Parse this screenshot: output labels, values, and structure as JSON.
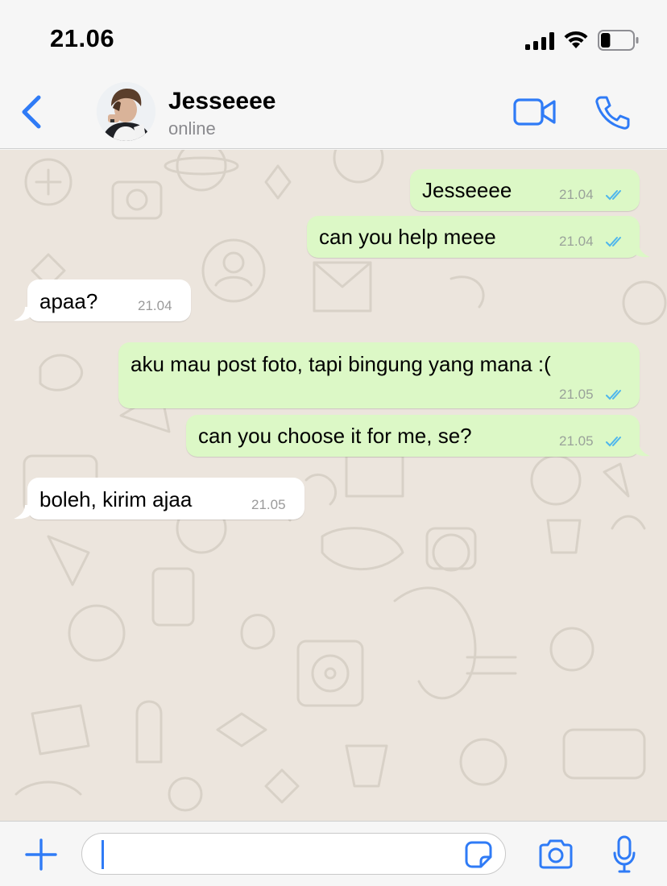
{
  "status_bar": {
    "time": "21.06",
    "battery_level": 0.3
  },
  "header": {
    "contact_name": "Jesseeee",
    "contact_status": "online",
    "accent_color": "#2f7bf6"
  },
  "messages": [
    {
      "direction": "outgoing",
      "text": "Jesseeee",
      "time": "21.04",
      "status": "read"
    },
    {
      "direction": "outgoing",
      "text": "can you help meee",
      "time": "21.04",
      "status": "read"
    },
    {
      "direction": "incoming",
      "text": "apaa?",
      "time": "21.04"
    },
    {
      "direction": "outgoing",
      "text": "aku mau post foto, tapi bingung yang mana :(",
      "time": "21.05",
      "status": "read"
    },
    {
      "direction": "outgoing",
      "text": "can you choose it for me, se?",
      "time": "21.05",
      "status": "read"
    },
    {
      "direction": "incoming",
      "text": "boleh, kirim ajaa",
      "time": "21.05"
    }
  ],
  "colors": {
    "outgoing_bubble": "#dcf8c6",
    "incoming_bubble": "#ffffff",
    "chat_background": "#ece5dd",
    "read_tick": "#4fb6ec"
  },
  "input": {
    "value": "",
    "placeholder": ""
  },
  "icons": [
    "back-chevron-icon",
    "video-camera-icon",
    "phone-icon",
    "plus-icon",
    "sticker-icon",
    "camera-icon",
    "microphone-icon"
  ]
}
